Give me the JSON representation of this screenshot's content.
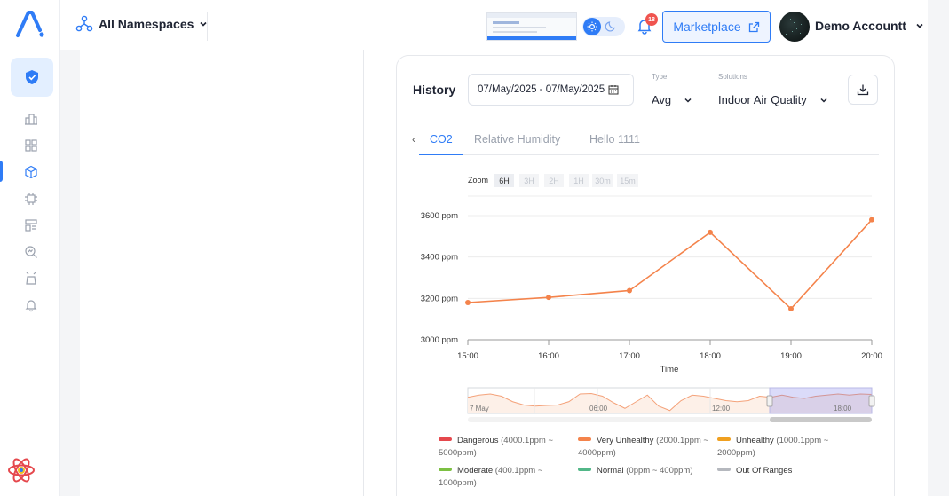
{
  "topbar": {
    "namespace": "All Namespaces",
    "notifications_count": "18",
    "marketplace_label": "Marketplace",
    "account_name": "Demo Accountt"
  },
  "history": {
    "title": "History",
    "date_range": "07/May/2025 - 07/May/2025",
    "type_label": "Type",
    "type_value": "Avg",
    "solutions_label": "Solutions",
    "solutions_value": "Indoor Air Quality",
    "tabs": [
      {
        "label": "CO2",
        "active": true
      },
      {
        "label": "Relative Humidity",
        "active": false
      },
      {
        "label": "Hello 1111",
        "active": false
      }
    ],
    "zoom": {
      "label": "Zoom",
      "options": [
        "6H",
        "3H",
        "2H",
        "1H",
        "30m",
        "15m"
      ],
      "selected": "6H"
    }
  },
  "chart_data": {
    "type": "line",
    "xlabel": "Time",
    "x_ticks": [
      "15:00",
      "16:00",
      "17:00",
      "18:00",
      "19:00",
      "20:00"
    ],
    "y_ticks": [
      "3000 ppm",
      "3200 ppm",
      "3400 ppm",
      "3600 ppm"
    ],
    "ylim": [
      3000,
      3600
    ],
    "grid": true,
    "series": [
      {
        "color": "#f4834b",
        "x": [
          "15:00",
          "16:00",
          "17:00",
          "18:00",
          "19:00",
          "20:00"
        ],
        "values": [
          3180,
          3205,
          3238,
          3519,
          3150,
          3580
        ]
      }
    ],
    "navigator": {
      "labels": [
        "7 May",
        "06:00",
        "12:00",
        "18:00"
      ]
    }
  },
  "legend": [
    {
      "name": "Dangerous",
      "range": "(4000.1ppm ~ 5000ppm)",
      "color": "#e5484d"
    },
    {
      "name": "Very Unhealthy",
      "range": "(2000.1ppm ~ 4000ppm)",
      "color": "#f4834b"
    },
    {
      "name": "Unhealthy",
      "range": "(1000.1ppm ~ 2000ppm)",
      "color": "#f0a020"
    },
    {
      "name": "Moderate",
      "range": "(400.1ppm ~ 1000ppm)",
      "color": "#7cc043"
    },
    {
      "name": "Normal",
      "range": "(0ppm ~ 400ppm)",
      "color": "#52b788"
    },
    {
      "name": "Out Of Ranges",
      "range": "",
      "color": "#b5b8be"
    }
  ]
}
